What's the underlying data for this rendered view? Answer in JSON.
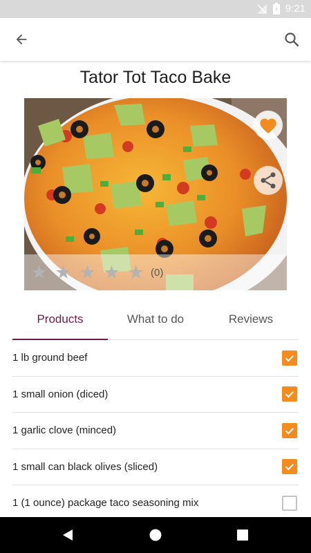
{
  "status": {
    "time": "9:21"
  },
  "recipe": {
    "title": "Tator Tot Taco Bake",
    "rating_count": "(0)"
  },
  "tabs": [
    {
      "label": "Products",
      "active": true
    },
    {
      "label": "What to do",
      "active": false
    },
    {
      "label": "Reviews",
      "active": false
    }
  ],
  "ingredients": [
    {
      "text": "1 lb ground beef",
      "checked": true
    },
    {
      "text": "1 small onion (diced)",
      "checked": true
    },
    {
      "text": "1 garlic clove (minced)",
      "checked": true
    },
    {
      "text": "1 small can black olives (sliced)",
      "checked": true
    },
    {
      "text": "1 (1 ounce) package taco seasoning mix",
      "checked": false
    }
  ],
  "icons": {
    "back": "arrow-back-icon",
    "search": "search-icon",
    "favorite": "heart-icon",
    "share": "share-icon",
    "star": "star-icon",
    "checkbox": "checkbox-icon"
  },
  "colors": {
    "accent": "#f28c1f",
    "tab_active": "#6e1a4a",
    "status_bar": "#d9d9d9",
    "nav_bar": "#000000"
  },
  "rating": {
    "stars_filled": 0,
    "stars_total": 5
  }
}
